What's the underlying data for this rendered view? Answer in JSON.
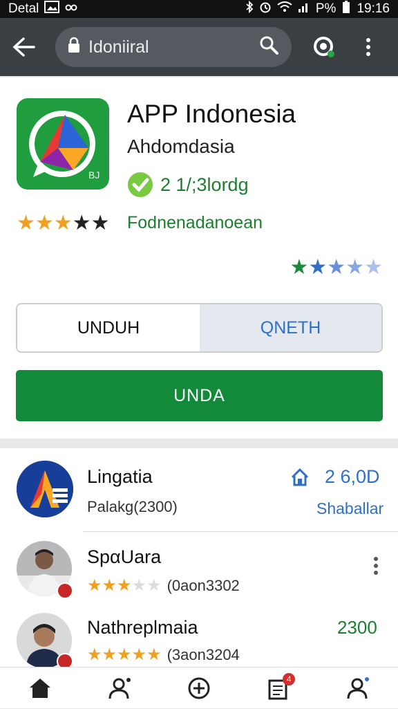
{
  "status_bar": {
    "left_label": "Detal",
    "battery_text": "P%",
    "time": "19:16"
  },
  "toolbar": {
    "search_text": "Idoniiral"
  },
  "app": {
    "title": "APP Indonesia",
    "developer": "Ahdomdasia",
    "verified_text": "2 1/;3lordg",
    "rating_stars": 3,
    "category": "Fodnenadanoean",
    "right_rating_stars": 5
  },
  "buttons": {
    "unduh": "UNDUH",
    "oneth": "QNETH",
    "install": "UNDA"
  },
  "list": [
    {
      "title": "Lingatia",
      "subtitle": "Palakg(2300)",
      "price": "2 6,0D",
      "link": "Shaballar"
    },
    {
      "title": "SpαUara",
      "reviews": "(0aon3302",
      "rating_stars": 3
    },
    {
      "title": "Nathreplmaia",
      "reviews": "(3aon3204",
      "rating_stars": 5,
      "right_value": "2300"
    }
  ],
  "nav": {
    "notifications": "4"
  },
  "colors": {
    "toolbar": "#3a3f44",
    "accent_green": "#128a3a",
    "blue": "#2f6fc7",
    "star_gold": "#f0a020"
  }
}
